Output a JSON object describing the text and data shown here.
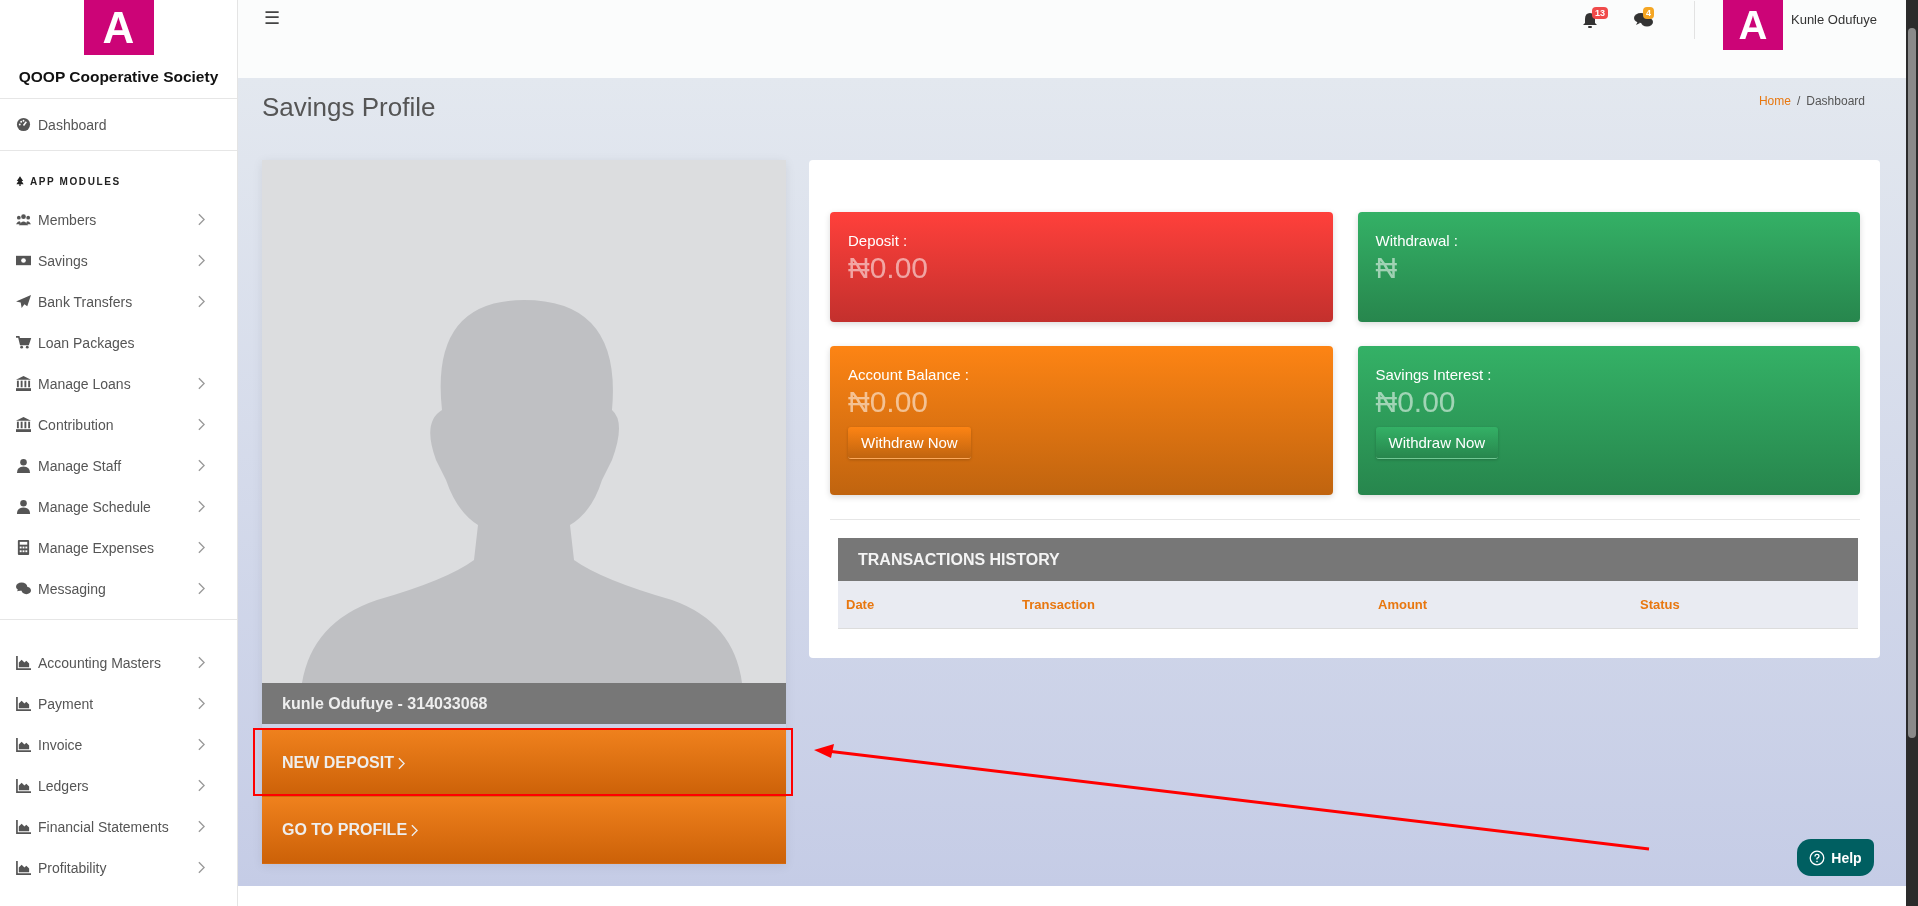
{
  "sidebar": {
    "logo_letter": "A",
    "title": "QOOP Cooperative Society",
    "dashboard": {
      "label": "Dashboard"
    },
    "sections": [
      {
        "heading": "APP MODULES",
        "items": [
          {
            "label": "Members",
            "has_submenu": true
          },
          {
            "label": "Savings",
            "has_submenu": true
          },
          {
            "label": "Bank Transfers",
            "has_submenu": true
          },
          {
            "label": "Loan Packages",
            "has_submenu": false
          },
          {
            "label": "Manage Loans",
            "has_submenu": true
          },
          {
            "label": "Contribution",
            "has_submenu": true
          },
          {
            "label": "Manage Staff",
            "has_submenu": true
          },
          {
            "label": "Manage Schedule",
            "has_submenu": true
          },
          {
            "label": "Manage Expenses",
            "has_submenu": true
          },
          {
            "label": "Messaging",
            "has_submenu": true
          }
        ]
      },
      {
        "items": [
          {
            "label": "Accounting Masters",
            "has_submenu": true
          },
          {
            "label": "Payment",
            "has_submenu": true
          },
          {
            "label": "Invoice",
            "has_submenu": true
          },
          {
            "label": "Ledgers",
            "has_submenu": true
          },
          {
            "label": "Financial Statements",
            "has_submenu": true
          },
          {
            "label": "Profitability",
            "has_submenu": true
          }
        ]
      }
    ]
  },
  "topbar": {
    "menu_glyph": "☰",
    "notifications": "13",
    "messages": "4",
    "avatar_letter": "A",
    "user_name": "Kunle Odufuye"
  },
  "page": {
    "title": "Savings Profile",
    "breadcrumb": [
      "Home",
      "Dashboard"
    ],
    "breadcrumb_separator": "/"
  },
  "profile": {
    "name": "kunle Odufuye - 314033068",
    "actions": [
      {
        "label": "NEW DEPOSIT",
        "highlighted": true
      },
      {
        "label": "GO TO PROFILE",
        "highlighted": false
      }
    ]
  },
  "cards": [
    {
      "label": "Deposit :",
      "value": "₦0.00",
      "color": "#e53935"
    },
    {
      "label": "Withdrawal :",
      "value": "₦",
      "color": "#2e9e5b"
    },
    {
      "label": "Account Balance :",
      "value": "₦0.00",
      "color": "#e27612",
      "button": "Withdraw Now"
    },
    {
      "label": "Savings Interest :",
      "value": "₦0.00",
      "color": "#2e9e5b",
      "button": "Withdraw Now"
    }
  ],
  "transactions": {
    "title": "TRANSACTIONS HISTORY",
    "columns": [
      "Date",
      "Transaction",
      "Amount",
      "Status"
    ]
  },
  "help": {
    "label": "Help"
  }
}
